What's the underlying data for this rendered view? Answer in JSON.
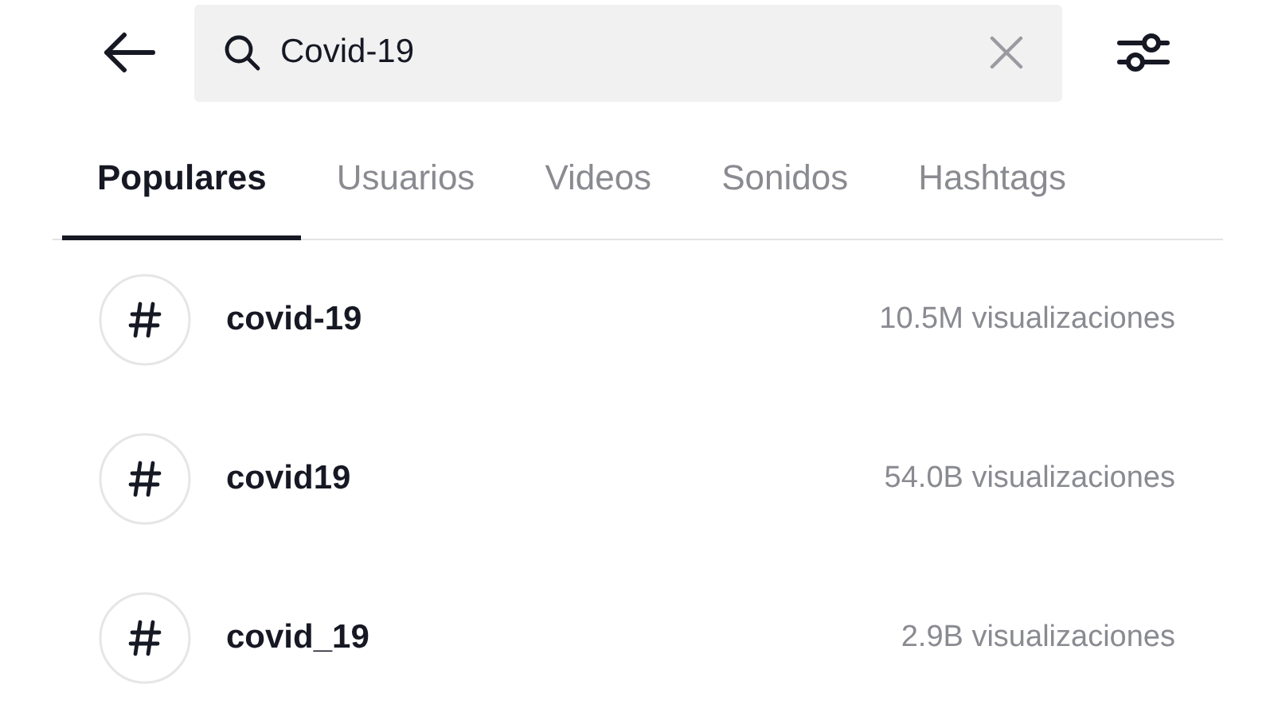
{
  "search": {
    "value": "Covid-19"
  },
  "tabs": [
    {
      "label": "Populares",
      "selected": true
    },
    {
      "label": "Usuarios",
      "selected": false
    },
    {
      "label": "Videos",
      "selected": false
    },
    {
      "label": "Sonidos",
      "selected": false
    },
    {
      "label": "Hashtags",
      "selected": false
    }
  ],
  "results": [
    {
      "name": "covid-19",
      "views": "10.5M visualizaciones"
    },
    {
      "name": "covid19",
      "views": "54.0B visualizaciones"
    },
    {
      "name": "covid_19",
      "views": "2.9B visualizaciones"
    }
  ]
}
